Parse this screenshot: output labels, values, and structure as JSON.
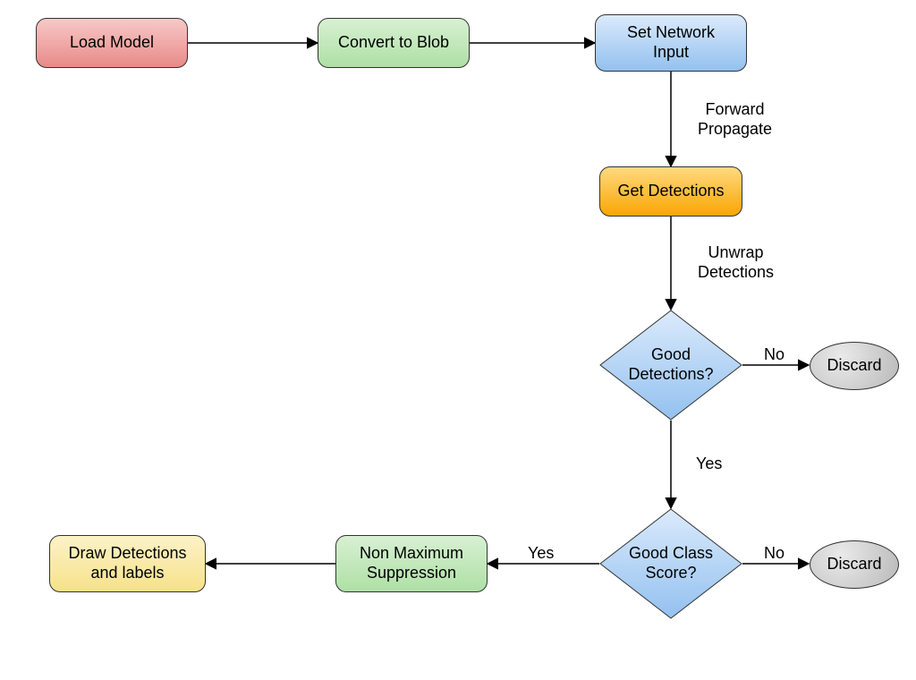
{
  "nodes": {
    "load_model": "Load Model",
    "convert_blob": "Convert to Blob",
    "set_input_l1": "Set Network",
    "set_input_l2": "Input",
    "get_detections": "Get Detections",
    "good_det_l1": "Good",
    "good_det_l2": "Detections?",
    "good_class_l1": "Good Class",
    "good_class_l2": "Score?",
    "nms_l1": "Non Maximum",
    "nms_l2": "Suppression",
    "draw_l1": "Draw Detections",
    "draw_l2": "and labels",
    "discard1": "Discard",
    "discard2": "Discard"
  },
  "edges": {
    "forward_l1": "Forward",
    "forward_l2": "Propagate",
    "unwrap_l1": "Unwrap",
    "unwrap_l2": "Detections",
    "no1": "No",
    "yes1": "Yes",
    "no2": "No",
    "yes2": "Yes"
  },
  "diagram": {
    "type": "flowchart",
    "flow": [
      {
        "from": "Load Model",
        "to": "Convert to Blob"
      },
      {
        "from": "Convert to Blob",
        "to": "Set Network Input"
      },
      {
        "from": "Set Network Input",
        "to": "Get Detections",
        "label": "Forward Propagate"
      },
      {
        "from": "Get Detections",
        "to": "Good Detections?",
        "label": "Unwrap Detections"
      },
      {
        "from": "Good Detections?",
        "to": "Discard",
        "label": "No"
      },
      {
        "from": "Good Detections?",
        "to": "Good Class Score?",
        "label": "Yes"
      },
      {
        "from": "Good Class Score?",
        "to": "Discard",
        "label": "No"
      },
      {
        "from": "Good Class Score?",
        "to": "Non Maximum Suppression",
        "label": "Yes"
      },
      {
        "from": "Non Maximum Suppression",
        "to": "Draw Detections and labels"
      }
    ]
  }
}
